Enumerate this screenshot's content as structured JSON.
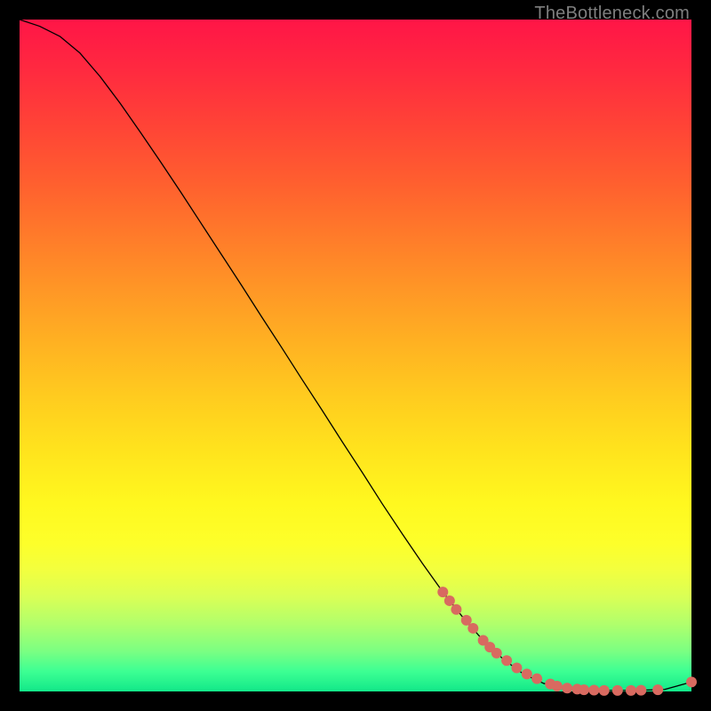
{
  "watermark": "TheBottleneck.com",
  "chart_data": {
    "type": "line",
    "title": "",
    "xlabel": "",
    "ylabel": "",
    "xlim": [
      0,
      100
    ],
    "ylim": [
      0,
      100
    ],
    "series": [
      {
        "name": "bottleneck-curve",
        "x": [
          0,
          3,
          6,
          9,
          12,
          15,
          18,
          21,
          24,
          27,
          30,
          33,
          36,
          39,
          42,
          45,
          48,
          51,
          54,
          57,
          60,
          63,
          66,
          69,
          72,
          75,
          78,
          81,
          84,
          87,
          90,
          93,
          96,
          100
        ],
        "y": [
          100,
          99,
          97.5,
          95,
          91.5,
          87.5,
          83.2,
          78.8,
          74.3,
          69.7,
          65.1,
          60.5,
          55.8,
          51.2,
          46.5,
          41.9,
          37.2,
          32.6,
          27.9,
          23.4,
          19.0,
          14.8,
          11.0,
          7.6,
          4.8,
          2.6,
          1.2,
          0.5,
          0.2,
          0.15,
          0.15,
          0.2,
          0.3,
          1.4
        ]
      }
    ],
    "markers": {
      "name": "highlight-points",
      "x": [
        63,
        64,
        65,
        66.5,
        67.5,
        69,
        70,
        71,
        72.5,
        74,
        75.5,
        77,
        79,
        80,
        81.5,
        83,
        84,
        85.5,
        87,
        89,
        91,
        92.5,
        95,
        100
      ],
      "y": [
        14.8,
        13.5,
        12.2,
        10.6,
        9.4,
        7.6,
        6.6,
        5.7,
        4.6,
        3.5,
        2.6,
        1.9,
        1.1,
        0.8,
        0.5,
        0.35,
        0.25,
        0.2,
        0.15,
        0.15,
        0.15,
        0.18,
        0.25,
        1.4
      ]
    }
  }
}
